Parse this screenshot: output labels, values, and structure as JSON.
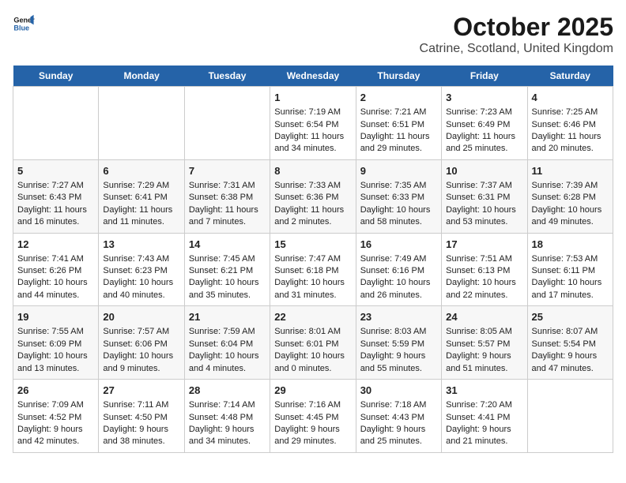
{
  "header": {
    "logo_general": "General",
    "logo_blue": "Blue",
    "title": "October 2025",
    "subtitle": "Catrine, Scotland, United Kingdom"
  },
  "days_of_week": [
    "Sunday",
    "Monday",
    "Tuesday",
    "Wednesday",
    "Thursday",
    "Friday",
    "Saturday"
  ],
  "weeks": [
    {
      "cells": [
        {
          "day": "",
          "content": ""
        },
        {
          "day": "",
          "content": ""
        },
        {
          "day": "",
          "content": ""
        },
        {
          "day": "1",
          "content": "Sunrise: 7:19 AM\nSunset: 6:54 PM\nDaylight: 11 hours and 34 minutes."
        },
        {
          "day": "2",
          "content": "Sunrise: 7:21 AM\nSunset: 6:51 PM\nDaylight: 11 hours and 29 minutes."
        },
        {
          "day": "3",
          "content": "Sunrise: 7:23 AM\nSunset: 6:49 PM\nDaylight: 11 hours and 25 minutes."
        },
        {
          "day": "4",
          "content": "Sunrise: 7:25 AM\nSunset: 6:46 PM\nDaylight: 11 hours and 20 minutes."
        }
      ]
    },
    {
      "cells": [
        {
          "day": "5",
          "content": "Sunrise: 7:27 AM\nSunset: 6:43 PM\nDaylight: 11 hours and 16 minutes."
        },
        {
          "day": "6",
          "content": "Sunrise: 7:29 AM\nSunset: 6:41 PM\nDaylight: 11 hours and 11 minutes."
        },
        {
          "day": "7",
          "content": "Sunrise: 7:31 AM\nSunset: 6:38 PM\nDaylight: 11 hours and 7 minutes."
        },
        {
          "day": "8",
          "content": "Sunrise: 7:33 AM\nSunset: 6:36 PM\nDaylight: 11 hours and 2 minutes."
        },
        {
          "day": "9",
          "content": "Sunrise: 7:35 AM\nSunset: 6:33 PM\nDaylight: 10 hours and 58 minutes."
        },
        {
          "day": "10",
          "content": "Sunrise: 7:37 AM\nSunset: 6:31 PM\nDaylight: 10 hours and 53 minutes."
        },
        {
          "day": "11",
          "content": "Sunrise: 7:39 AM\nSunset: 6:28 PM\nDaylight: 10 hours and 49 minutes."
        }
      ]
    },
    {
      "cells": [
        {
          "day": "12",
          "content": "Sunrise: 7:41 AM\nSunset: 6:26 PM\nDaylight: 10 hours and 44 minutes."
        },
        {
          "day": "13",
          "content": "Sunrise: 7:43 AM\nSunset: 6:23 PM\nDaylight: 10 hours and 40 minutes."
        },
        {
          "day": "14",
          "content": "Sunrise: 7:45 AM\nSunset: 6:21 PM\nDaylight: 10 hours and 35 minutes."
        },
        {
          "day": "15",
          "content": "Sunrise: 7:47 AM\nSunset: 6:18 PM\nDaylight: 10 hours and 31 minutes."
        },
        {
          "day": "16",
          "content": "Sunrise: 7:49 AM\nSunset: 6:16 PM\nDaylight: 10 hours and 26 minutes."
        },
        {
          "day": "17",
          "content": "Sunrise: 7:51 AM\nSunset: 6:13 PM\nDaylight: 10 hours and 22 minutes."
        },
        {
          "day": "18",
          "content": "Sunrise: 7:53 AM\nSunset: 6:11 PM\nDaylight: 10 hours and 17 minutes."
        }
      ]
    },
    {
      "cells": [
        {
          "day": "19",
          "content": "Sunrise: 7:55 AM\nSunset: 6:09 PM\nDaylight: 10 hours and 13 minutes."
        },
        {
          "day": "20",
          "content": "Sunrise: 7:57 AM\nSunset: 6:06 PM\nDaylight: 10 hours and 9 minutes."
        },
        {
          "day": "21",
          "content": "Sunrise: 7:59 AM\nSunset: 6:04 PM\nDaylight: 10 hours and 4 minutes."
        },
        {
          "day": "22",
          "content": "Sunrise: 8:01 AM\nSunset: 6:01 PM\nDaylight: 10 hours and 0 minutes."
        },
        {
          "day": "23",
          "content": "Sunrise: 8:03 AM\nSunset: 5:59 PM\nDaylight: 9 hours and 55 minutes."
        },
        {
          "day": "24",
          "content": "Sunrise: 8:05 AM\nSunset: 5:57 PM\nDaylight: 9 hours and 51 minutes."
        },
        {
          "day": "25",
          "content": "Sunrise: 8:07 AM\nSunset: 5:54 PM\nDaylight: 9 hours and 47 minutes."
        }
      ]
    },
    {
      "cells": [
        {
          "day": "26",
          "content": "Sunrise: 7:09 AM\nSunset: 4:52 PM\nDaylight: 9 hours and 42 minutes."
        },
        {
          "day": "27",
          "content": "Sunrise: 7:11 AM\nSunset: 4:50 PM\nDaylight: 9 hours and 38 minutes."
        },
        {
          "day": "28",
          "content": "Sunrise: 7:14 AM\nSunset: 4:48 PM\nDaylight: 9 hours and 34 minutes."
        },
        {
          "day": "29",
          "content": "Sunrise: 7:16 AM\nSunset: 4:45 PM\nDaylight: 9 hours and 29 minutes."
        },
        {
          "day": "30",
          "content": "Sunrise: 7:18 AM\nSunset: 4:43 PM\nDaylight: 9 hours and 25 minutes."
        },
        {
          "day": "31",
          "content": "Sunrise: 7:20 AM\nSunset: 4:41 PM\nDaylight: 9 hours and 21 minutes."
        },
        {
          "day": "",
          "content": ""
        }
      ]
    }
  ]
}
